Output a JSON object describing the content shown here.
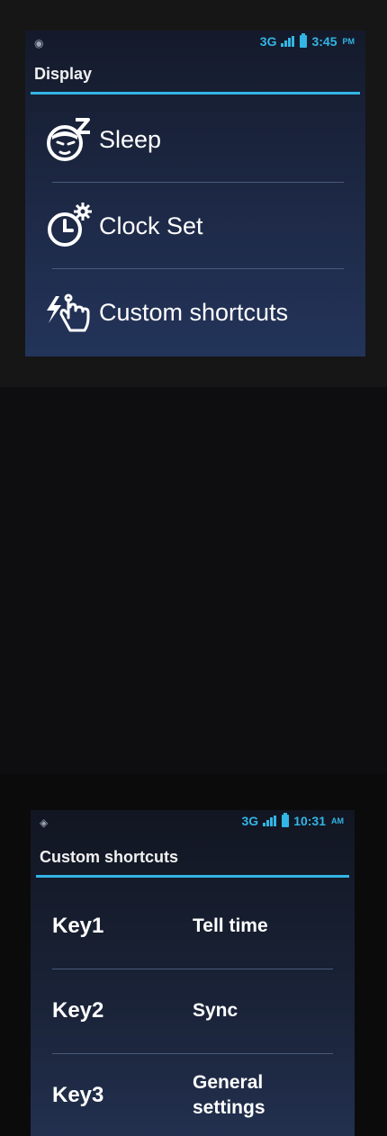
{
  "panel1": {
    "status": {
      "network": "3G",
      "time": "3:45",
      "ampm": "PM"
    },
    "title": "Display",
    "items": [
      {
        "label": "Sleep",
        "icon": "sleep-face-icon"
      },
      {
        "label": "Clock Set",
        "icon": "clock-gear-icon"
      },
      {
        "label": "Custom shortcuts",
        "icon": "touch-hand-icon"
      }
    ]
  },
  "panel2": {
    "status": {
      "network": "3G",
      "time": "10:31",
      "ampm": "AM"
    },
    "title": "Custom shortcuts",
    "rows": [
      {
        "key": "Key1",
        "action": "Tell time"
      },
      {
        "key": "Key2",
        "action": "Sync"
      },
      {
        "key": "Key3",
        "action": "General settings"
      }
    ]
  },
  "colors": {
    "accent": "#33b5e5",
    "screen_bg": "#1d2946"
  }
}
